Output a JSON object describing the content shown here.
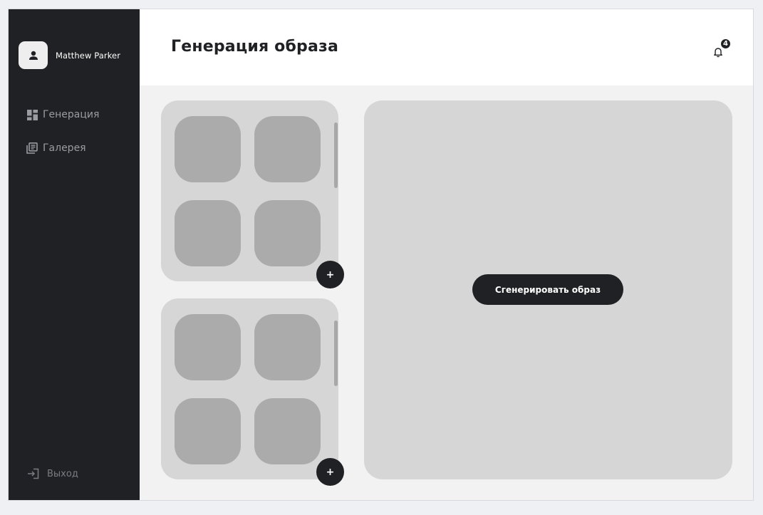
{
  "sidebar": {
    "user_name": "Matthew Parker",
    "nav": [
      {
        "label": "Генерация",
        "icon": "dashboard-icon"
      },
      {
        "label": "Галерея",
        "icon": "library-icon"
      }
    ],
    "logout_label": "Выход"
  },
  "header": {
    "title": "Генерация образа",
    "notification_count": "4"
  },
  "panels": [
    {
      "add_label": "+"
    },
    {
      "add_label": "+"
    }
  ],
  "result": {
    "generate_label": "Сгенерировать образ"
  },
  "colors": {
    "sidebar_bg": "#202124",
    "panel_bg": "#d6d6d6",
    "tile_bg": "#ababab",
    "accent": "#202124"
  }
}
